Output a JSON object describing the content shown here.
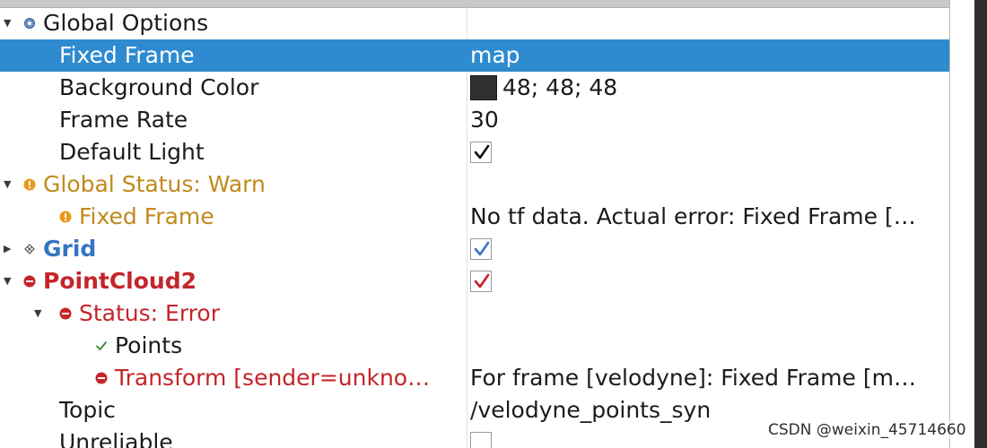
{
  "display_tree": {
    "global_options": {
      "label": "Global Options",
      "icon": "gear-icon",
      "fixed_frame": {
        "label": "Fixed Frame",
        "value": "map"
      },
      "background_color": {
        "label": "Background Color",
        "value": "48; 48; 48",
        "swatch_color": "#303030"
      },
      "frame_rate": {
        "label": "Frame Rate",
        "value": "30"
      },
      "default_light": {
        "label": "Default Light",
        "checked": true
      }
    },
    "global_status": {
      "label": "Global Status: Warn",
      "icon": "warning-icon",
      "fixed_frame": {
        "label": "Fixed Frame",
        "value": "No tf data.  Actual error: Fixed Frame […"
      }
    },
    "grid": {
      "label": "Grid",
      "icon": "grid-icon",
      "checked": true
    },
    "pointcloud2": {
      "label": "PointCloud2",
      "icon": "error-icon",
      "checked": true,
      "status": {
        "label": "Status: Error",
        "points": {
          "label": "Points"
        },
        "transform": {
          "label": "Transform [sender=unkno…",
          "value": "For frame [velodyne]: Fixed Frame [m…"
        }
      },
      "topic": {
        "label": "Topic",
        "value": "/velodyne_points_syn"
      },
      "unreliable": {
        "label": "Unreliable",
        "checked": false
      }
    }
  },
  "colors": {
    "selection": "#2e8bcf",
    "warn": "#c08a1c",
    "error": "#c4252a",
    "ok": "#3575c4"
  },
  "watermark": "CSDN @weixin_45714660"
}
